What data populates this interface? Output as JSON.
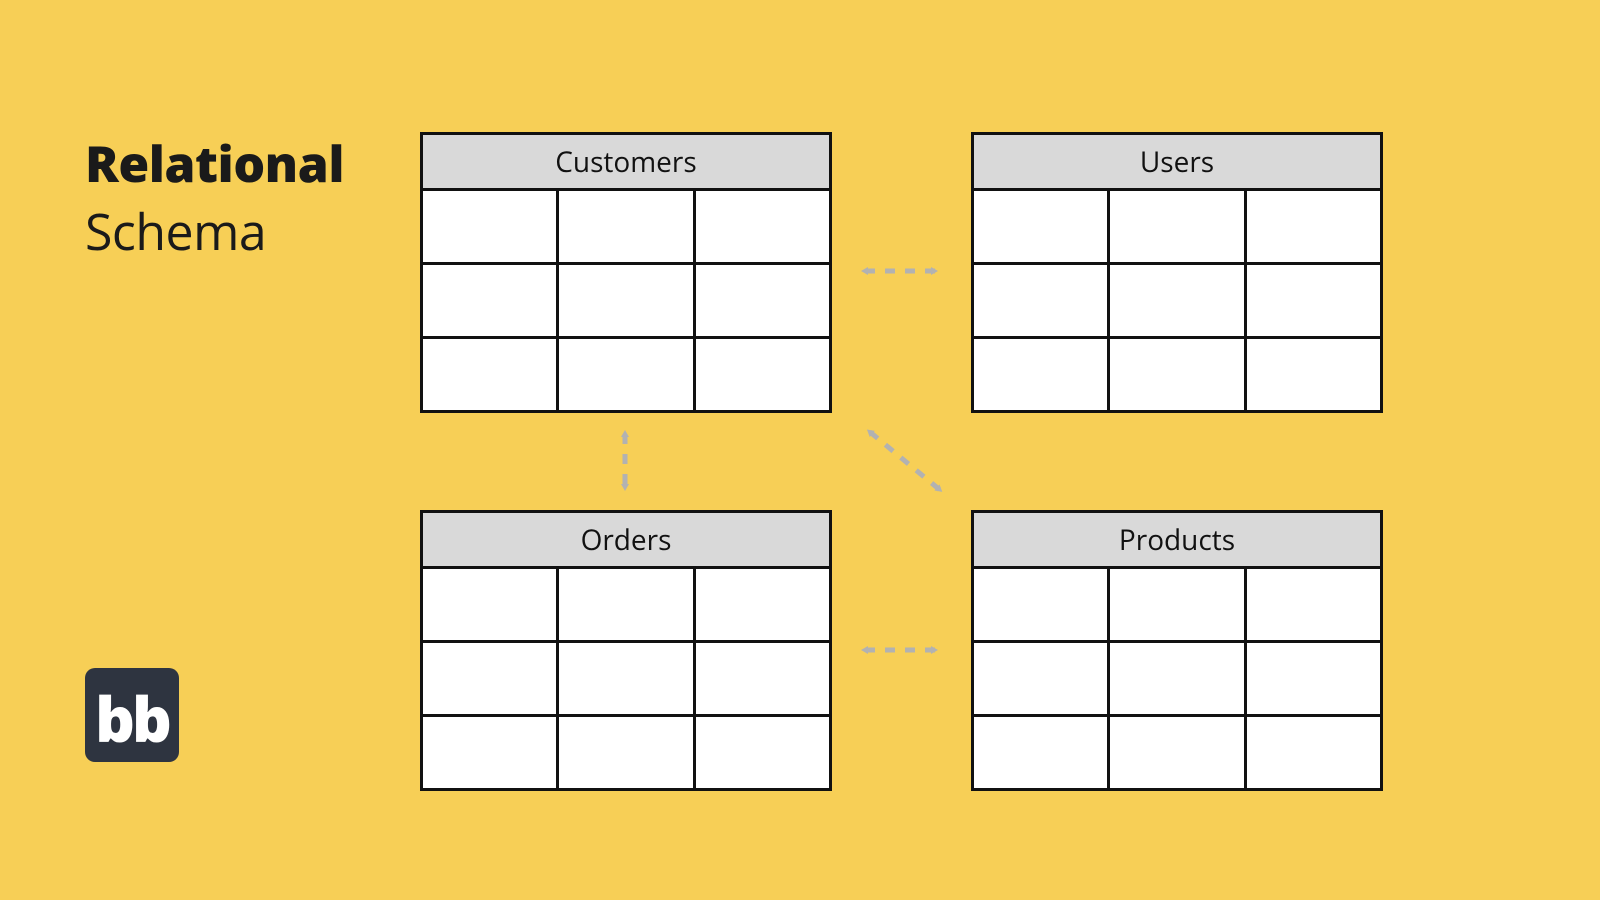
{
  "title": {
    "line1": "Relational",
    "line2": "Schema"
  },
  "logo_text": "bb",
  "tables": {
    "customers": {
      "label": "Customers",
      "rows": 3,
      "cols": 3
    },
    "users": {
      "label": "Users",
      "rows": 3,
      "cols": 3
    },
    "orders": {
      "label": "Orders",
      "rows": 3,
      "cols": 3
    },
    "products": {
      "label": "Products",
      "rows": 3,
      "cols": 3
    }
  },
  "relations": [
    {
      "from": "customers",
      "to": "users",
      "style": "dashed-bidirectional"
    },
    {
      "from": "customers",
      "to": "orders",
      "style": "dashed-bidirectional"
    },
    {
      "from": "orders",
      "to": "products",
      "style": "dashed-bidirectional"
    },
    {
      "from": "users",
      "to": "orders",
      "style": "dashed-bidirectional-diagonal"
    }
  ],
  "colors": {
    "background": "#f7cf56",
    "table_header": "#d9d9d9",
    "border": "#111111",
    "arrow": "#b2b2b2",
    "logo_bg": "#2e3440"
  }
}
